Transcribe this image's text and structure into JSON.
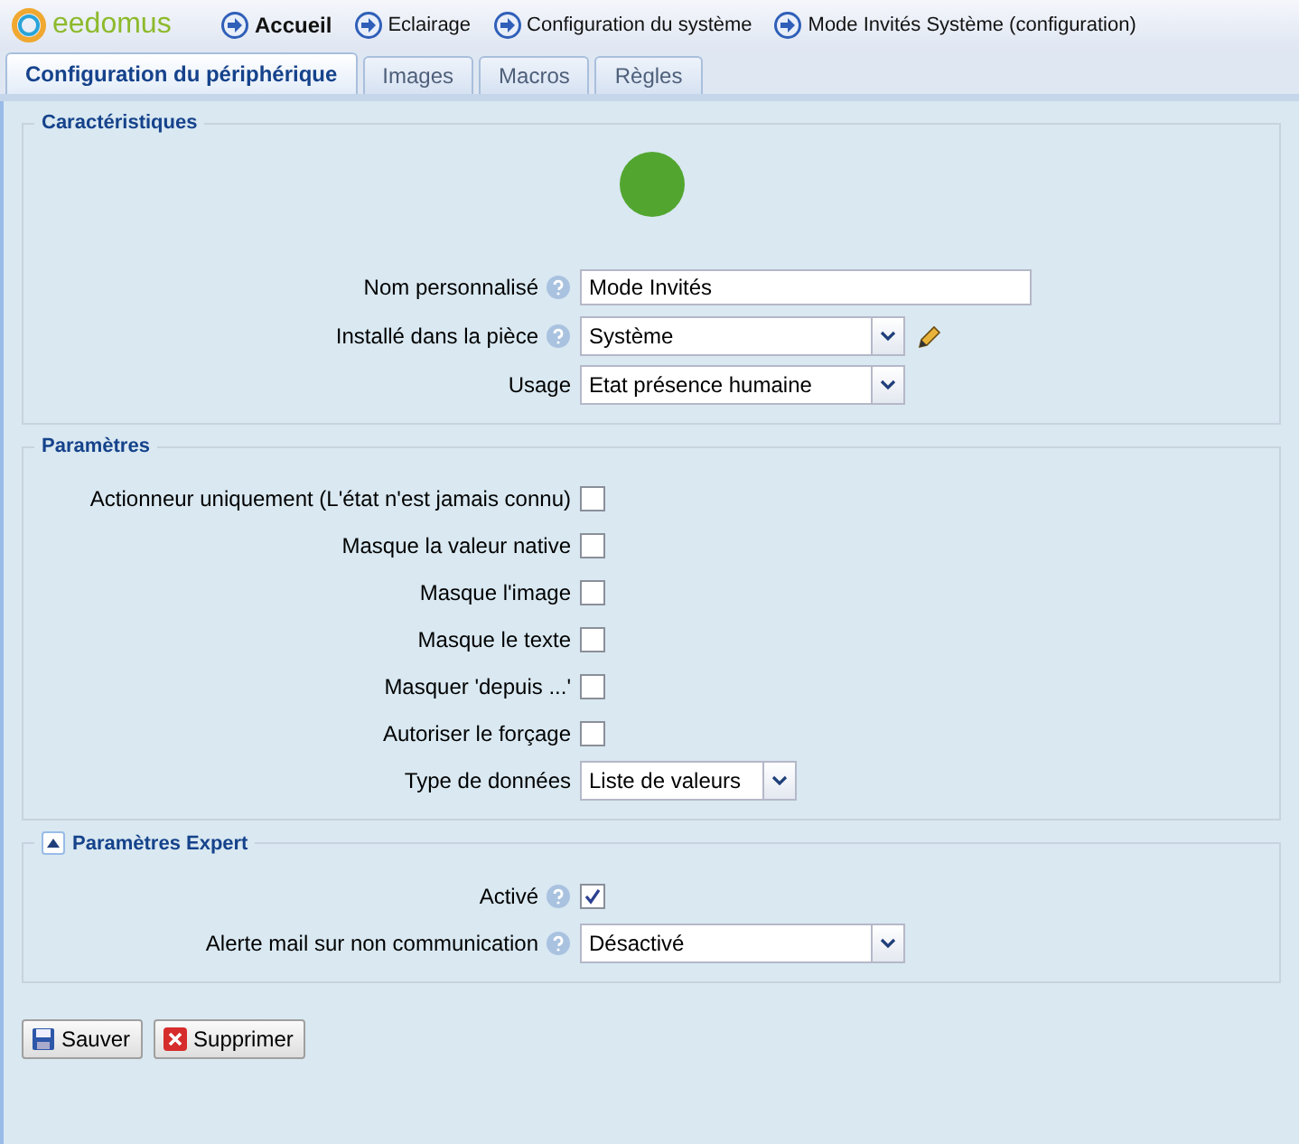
{
  "logo": {
    "text": "eedomus"
  },
  "breadcrumbs": [
    {
      "label": "Accueil",
      "selected": true
    },
    {
      "label": "Eclairage",
      "selected": false
    },
    {
      "label": "Configuration du système",
      "selected": false
    },
    {
      "label": "Mode Invités Système (configuration)",
      "selected": false
    }
  ],
  "tabs": [
    {
      "label": "Configuration du périphérique",
      "selected": true
    },
    {
      "label": "Images",
      "selected": false
    },
    {
      "label": "Macros",
      "selected": false
    },
    {
      "label": "Règles",
      "selected": false
    }
  ],
  "sections": [
    {
      "title": "Caractéristiques",
      "indicator_on": true,
      "fields": [
        {
          "kind": "text",
          "label": "Nom personnalisé",
          "help": true,
          "value": "Mode Invités"
        },
        {
          "kind": "select",
          "label": "Installé dans la pièce",
          "help": true,
          "value": "Système",
          "editable": true
        },
        {
          "kind": "select",
          "label": "Usage",
          "help": false,
          "value": "Etat présence humaine",
          "editable": false
        }
      ]
    },
    {
      "title": "Paramètres",
      "fields": [
        {
          "kind": "checkbox",
          "label": "Actionneur uniquement (L'état n'est jamais connu)",
          "help": false,
          "checked": false
        },
        {
          "kind": "checkbox",
          "label": "Masque la valeur native",
          "help": false,
          "checked": false
        },
        {
          "kind": "checkbox",
          "label": "Masque l'image",
          "help": false,
          "checked": false
        },
        {
          "kind": "checkbox",
          "label": "Masque le texte",
          "help": false,
          "checked": false
        },
        {
          "kind": "checkbox",
          "label": "Masquer 'depuis ...'",
          "help": false,
          "checked": false
        },
        {
          "kind": "checkbox",
          "label": "Autoriser le forçage",
          "help": false,
          "checked": false
        },
        {
          "kind": "select",
          "label": "Type de données",
          "help": false,
          "value": "Liste de valeurs",
          "editable": false
        }
      ]
    },
    {
      "title": "Paramètres Expert",
      "expanded": true,
      "fields": [
        {
          "kind": "checkbox",
          "label": "Activé",
          "help": true,
          "checked": true
        },
        {
          "kind": "select",
          "label": "Alerte mail sur non communication",
          "help": true,
          "value": "Désactivé",
          "editable": false
        }
      ]
    }
  ],
  "buttons": [
    {
      "kind": "save",
      "label": "Sauver"
    },
    {
      "kind": "delete",
      "label": "Supprimer"
    }
  ]
}
